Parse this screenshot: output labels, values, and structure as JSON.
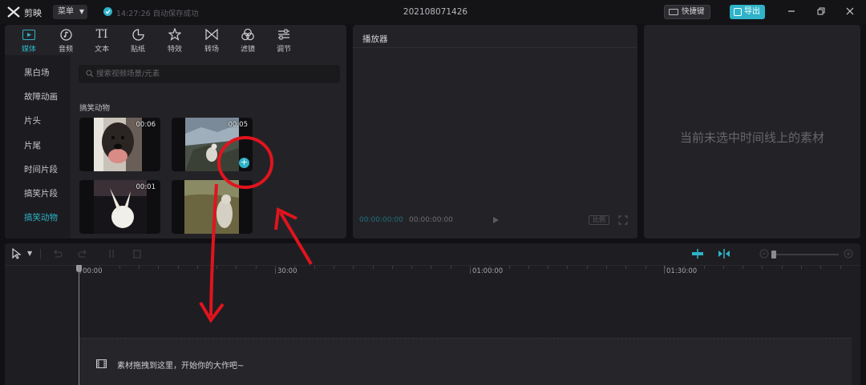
{
  "titlebar": {
    "app_name": "剪映",
    "menu_label": "菜单",
    "save_status": "14:27:26 自动保存成功",
    "doc_title": "202108071426",
    "shortcut_label": "快捷键",
    "export_label": "导出"
  },
  "tabs": [
    {
      "label": "媒体",
      "icon": "media-icon"
    },
    {
      "label": "音频",
      "icon": "audio-icon"
    },
    {
      "label": "文本",
      "icon": "text-icon"
    },
    {
      "label": "贴纸",
      "icon": "sticker-icon"
    },
    {
      "label": "特效",
      "icon": "effects-icon"
    },
    {
      "label": "转场",
      "icon": "transition-icon"
    },
    {
      "label": "滤镜",
      "icon": "filter-icon"
    },
    {
      "label": "调节",
      "icon": "adjust-icon"
    }
  ],
  "sidebar": {
    "items": [
      "黑白场",
      "故障动画",
      "片头",
      "片尾",
      "时间片段",
      "搞笑片段",
      "搞笑动物"
    ],
    "active_index": 6
  },
  "search": {
    "placeholder": "搜索视频场景/元素"
  },
  "library": {
    "section_title": "搞笑动物",
    "clips": [
      {
        "duration": "00:06"
      },
      {
        "duration": "00:05"
      },
      {
        "duration": "00:01"
      },
      {
        "duration": ""
      }
    ]
  },
  "player": {
    "title": "播放器",
    "current_time": "00:00:00:00",
    "total_time": "00:00:00:00",
    "ratio_label": "比例"
  },
  "attributes": {
    "empty_text": "当前未选中时间线上的素材"
  },
  "timeline": {
    "ruler_labels": [
      "00:00",
      "30:00",
      "01:00:00",
      "01:30:00"
    ],
    "drop_hint": "素材拖拽到这里，开始你的大作吧~"
  },
  "colors": {
    "accent": "#2fb3c8",
    "annotation": "#e0141e"
  }
}
